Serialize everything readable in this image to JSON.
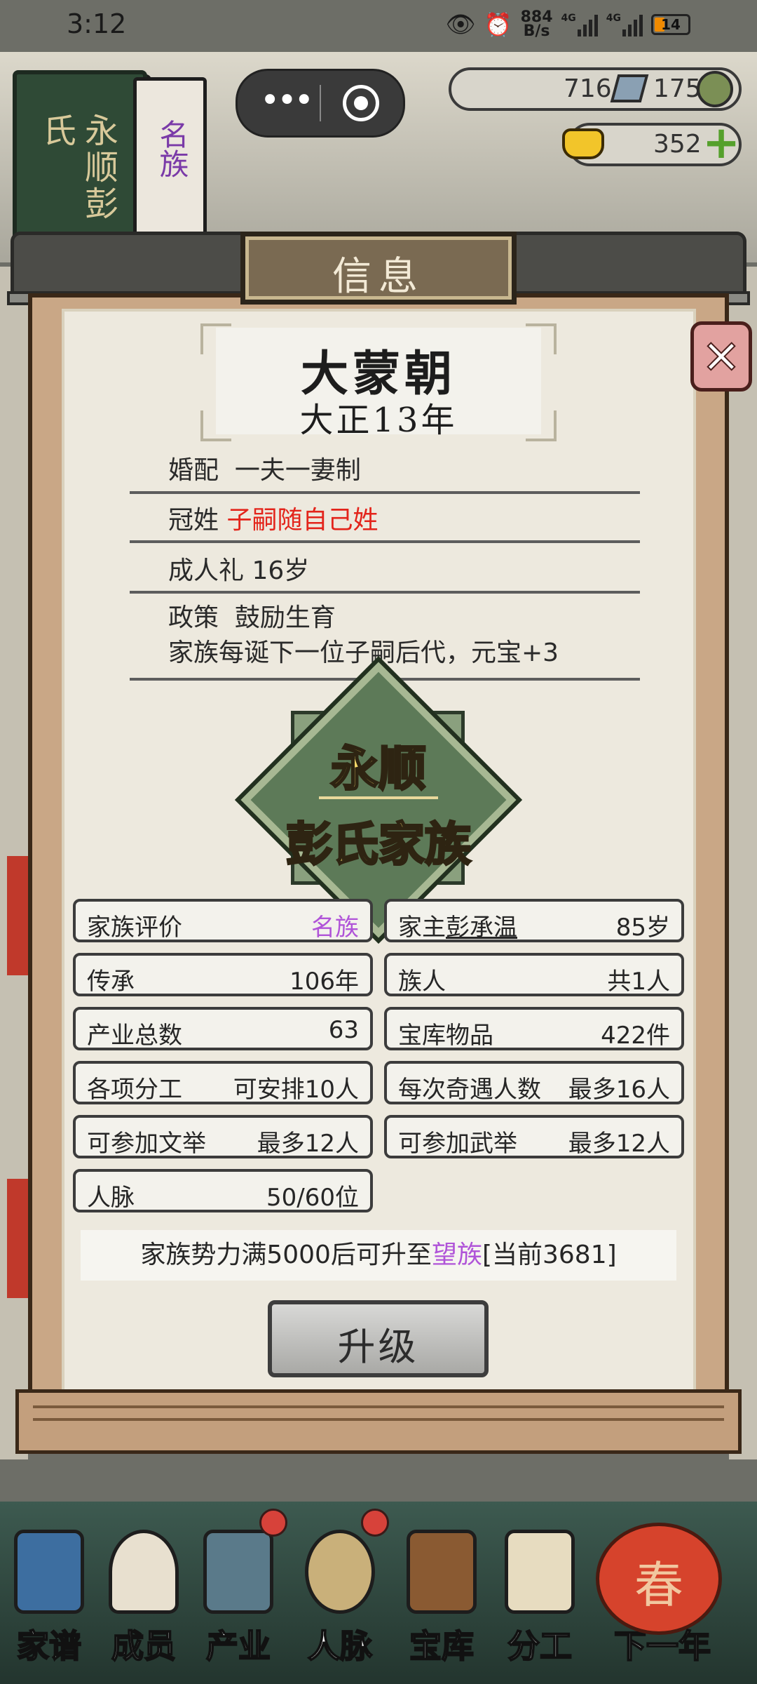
{
  "status_bar": {
    "time": "3:12",
    "net_speed_value": "884",
    "net_speed_unit": "B/s",
    "signal_1_label": "4G",
    "signal_2_label": "4G",
    "battery_level": "14"
  },
  "hud": {
    "family_place": "永顺",
    "family_surname": "彭氏",
    "rank_tab": "名族",
    "resource_silver": "716",
    "resource_coins": "175",
    "resource_gold": "352"
  },
  "dialog": {
    "title": "信息",
    "dynasty": {
      "name": "大蒙朝",
      "year": "大正13年"
    },
    "laws": [
      {
        "label": "婚配",
        "value": "一夫一妻制"
      },
      {
        "label": "冠姓",
        "value": "子嗣随自己姓"
      },
      {
        "label": "成人礼",
        "value": "16岁"
      },
      {
        "label": "政策",
        "value": "鼓励生育",
        "detail": "家族每诞下一位子嗣后代，元宝+3"
      }
    ],
    "emblem": {
      "line1": "永顺",
      "line2": "彭氏家族"
    },
    "stats": [
      {
        "label": "家族评价",
        "value": "名族"
      },
      {
        "label": "家主",
        "name": "彭承温",
        "value": "85岁"
      },
      {
        "label": "传承",
        "value": "106年"
      },
      {
        "label": "族人",
        "value": "共1人"
      },
      {
        "label": "产业总数",
        "value": "63"
      },
      {
        "label": "宝库物品",
        "value": "422件"
      },
      {
        "label": "各项分工",
        "value": "可安排10人"
      },
      {
        "label": "每次奇遇人数",
        "value": "最多16人"
      },
      {
        "label": "可参加文举",
        "value": "最多12人"
      },
      {
        "label": "可参加武举",
        "value": "最多12人"
      },
      {
        "label": "人脉",
        "value": "50/60位"
      }
    ],
    "progress": {
      "prefix": "家族势力满5000后可升至",
      "next_rank": "望族",
      "current": "[当前3681]"
    },
    "upgrade_label": "升级"
  },
  "bottom_nav": [
    {
      "label": "家谱"
    },
    {
      "label": "成员"
    },
    {
      "label": "产业"
    },
    {
      "label": "人脉"
    },
    {
      "label": "宝库"
    },
    {
      "label": "分工"
    },
    {
      "label": "下一年"
    }
  ],
  "lantern_text": "春",
  "colors": {
    "red_text": "#e3241b",
    "purple_text": "#b054d8",
    "panel_paper": "#ede9de",
    "emblem_gold": "#f4d86a"
  }
}
